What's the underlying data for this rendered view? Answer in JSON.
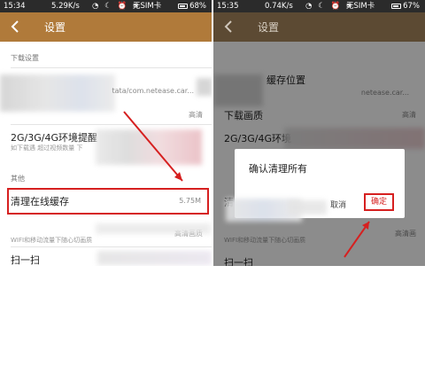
{
  "left": {
    "status": {
      "time": "15:34",
      "speed": "5.29K/s",
      "sys_icons": "◔ ☾ ⏰ ≋",
      "carrier": "无SIM卡",
      "battery": "68%"
    },
    "title": "设置",
    "download_section": "下载设置",
    "path_text": "tata/com.netease.car...",
    "quality_value": "高清",
    "network_tip_label": "2G/3G/4G环境提醒",
    "network_tip_sub": "如下载遇 超过视频数量 下",
    "other_section": "其他",
    "clear_cache_label": "清理在线缓存",
    "clear_cache_size": "5.75M",
    "mobile_sub": "WIFI和移动流量下随心切画质",
    "mobile_value": "高清画质",
    "scan_label": "扫一扫"
  },
  "right": {
    "status": {
      "time": "15:35",
      "speed": "0.74K/s",
      "sys_icons": "◔ ☾ ⏰ ≋",
      "carrier": "无SIM卡",
      "battery": "67%"
    },
    "title": "设置",
    "row1_label": "缓存位置",
    "row1_sub": "netease.car...",
    "download_quality_label": "下载画质",
    "quality_value": "高清",
    "network_tip_label": "2G/3G/4G环境",
    "mobile_sub": "WIFI和移动流量下随心切画质",
    "mobile_value": "高清画",
    "scan_label": "扫一扫",
    "clear_prefix": "清",
    "dialog": {
      "title": "确认清理所有",
      "cancel": "取消",
      "confirm": "确定"
    }
  }
}
